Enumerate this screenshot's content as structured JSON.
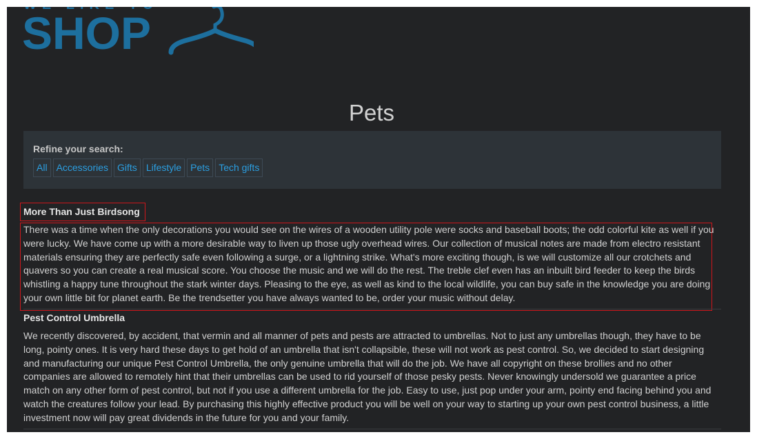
{
  "logo": {
    "tagline": "WE LIKE TO",
    "word": "SHOP",
    "color": "#1d6f9e"
  },
  "page_title": "Pets",
  "filters": {
    "label": "Refine your search:",
    "categories": [
      "All",
      "Accessories",
      "Gifts",
      "Lifestyle",
      "Pets",
      "Tech gifts"
    ]
  },
  "products": [
    {
      "title": "More Than Just Birdsong",
      "description": "There was a time when the only decorations you would see on the wires of a wooden utility pole were socks and baseball boots; the odd colorful kite as well if you were lucky. We have come up with a more desirable way to liven up those ugly overhead wires. Our collection of musical notes are made from electro resistant materials ensuring they are perfectly safe even following a surge, or a lightning strike. What's more exciting though, is we will customize all our crotchets and quavers so you can create a real musical score. You choose the music and we will do the rest. The treble clef even has an inbuilt bird feeder to keep the birds whistling a happy tune throughout the stark winter days. Pleasing to the eye, as well as kind to the local wildlife, you can buy safe in the knowledge you are doing your own little bit for planet earth. Be the trendsetter you have always wanted to be, order your music without delay."
    },
    {
      "title": "Pest Control Umbrella",
      "description": "We recently discovered, by accident, that vermin and all manner of pets and pests are attracted to umbrellas. Not to just any umbrellas though, they have to be long, pointy ones. It is very hard these days to get hold of an umbrella that isn't collapsible, these will not work as pest control. So, we decided to start designing and manufacturing our unique Pest Control Umbrella, the only genuine umbrella that will do the job. We have all copyright on these brollies and no other companies are allowed to remotely hint that their umbrellas can be used to rid yourself of those pesky pests. Never knowingly undersold we guarantee a price match on any other form of pest control, but not if you use a different umbrella for the job. Easy to use, just pop under your arm, pointy end facing behind you and watch the creatures follow your lead. By purchasing this highly effective product you will be well on your way to starting up your own pest control business, a little investment now will pay great dividends in the future for you and your family."
    }
  ],
  "highlight_color": "#d0161b"
}
